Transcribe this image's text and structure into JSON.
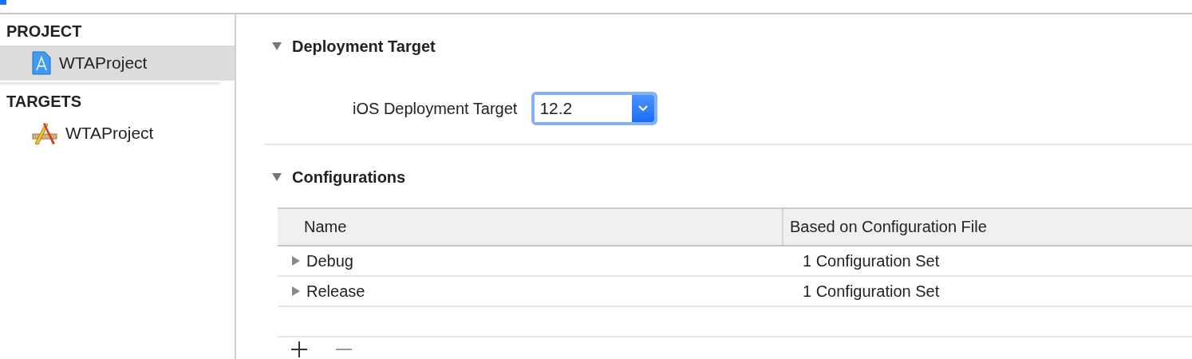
{
  "sidebar": {
    "sections": [
      {
        "title": "PROJECT",
        "items": [
          {
            "label": "WTAProject",
            "kind": "project",
            "selected": true
          }
        ]
      },
      {
        "title": "TARGETS",
        "items": [
          {
            "label": "WTAProject",
            "kind": "app",
            "selected": false
          }
        ]
      }
    ]
  },
  "deployment": {
    "title": "Deployment Target",
    "expanded": true,
    "label": "iOS Deployment Target",
    "value": "12.2"
  },
  "configurations": {
    "title": "Configurations",
    "expanded": true,
    "columns": [
      "Name",
      "Based on Configuration File"
    ],
    "rows": [
      {
        "name": "Debug",
        "file": "1 Configuration Set",
        "expanded": false
      },
      {
        "name": "Release",
        "file": "1 Configuration Set",
        "expanded": false
      }
    ]
  }
}
